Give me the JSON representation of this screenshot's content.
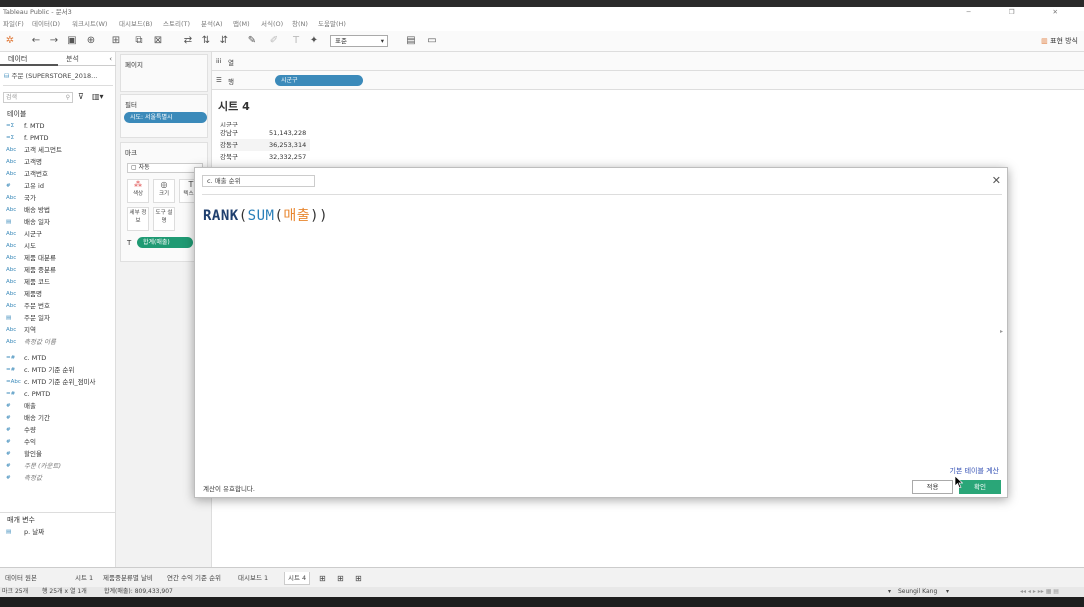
{
  "window": {
    "title": "Tableau Public - 문서3"
  },
  "menu": [
    "파일(F)",
    "데이터(D)",
    "워크시트(W)",
    "대시보드(B)",
    "스토리(T)",
    "분석(A)",
    "맵(M)",
    "서식(O)",
    "창(N)",
    "도움말(H)"
  ],
  "toolbar": {
    "fit_value": "표준",
    "show_me_label": "표현 방식"
  },
  "data_pane": {
    "tab_data": "데이터",
    "tab_analytics": "분석",
    "datasource": "주문 (SUPERSTORE_2018...",
    "search_placeholder": "검색",
    "tables_header": "테이블",
    "fields": [
      {
        "icon": "=Σ",
        "name": "f. MTD"
      },
      {
        "icon": "=Σ",
        "name": "f. PMTD"
      },
      {
        "icon": "Abc",
        "name": "고객 세그먼트"
      },
      {
        "icon": "Abc",
        "name": "고객명"
      },
      {
        "icon": "Abc",
        "name": "고객번호"
      },
      {
        "icon": "#",
        "name": "고유 id"
      },
      {
        "icon": "Abc",
        "name": "국가"
      },
      {
        "icon": "Abc",
        "name": "배송 방법"
      },
      {
        "icon": "▤",
        "name": "배송 일자"
      },
      {
        "icon": "Abc",
        "name": "시군구"
      },
      {
        "icon": "Abc",
        "name": "시도"
      },
      {
        "icon": "Abc",
        "name": "제품 대분류"
      },
      {
        "icon": "Abc",
        "name": "제품 중분류"
      },
      {
        "icon": "Abc",
        "name": "제품 코드"
      },
      {
        "icon": "Abc",
        "name": "제품명"
      },
      {
        "icon": "Abc",
        "name": "주문 번호"
      },
      {
        "icon": "▤",
        "name": "주문 일자"
      },
      {
        "icon": "Abc",
        "name": "지역"
      },
      {
        "icon": "Abc",
        "name": "측정값 이름",
        "italic": true
      },
      {
        "icon": "=#",
        "name": "c. MTD"
      },
      {
        "icon": "=#",
        "name": "c. MTD 기준 순위"
      },
      {
        "icon": "=Abc",
        "name": "c. MTD 기준 순위_점미사"
      },
      {
        "icon": "=#",
        "name": "c. PMTD"
      },
      {
        "icon": "#",
        "name": "매출"
      },
      {
        "icon": "#",
        "name": "배송 기간"
      },
      {
        "icon": "#",
        "name": "수량"
      },
      {
        "icon": "#",
        "name": "수익"
      },
      {
        "icon": "#",
        "name": "할인율"
      },
      {
        "icon": "#",
        "name": "주문 (카운트)",
        "italic": true
      },
      {
        "icon": "#",
        "name": "측정값",
        "italic": true
      }
    ],
    "params_header": "매개 변수",
    "params": [
      {
        "icon": "▤",
        "name": "p. 날짜"
      }
    ]
  },
  "shelves": {
    "pages_label": "페이지",
    "filters_label": "필터",
    "filter_pill": "시도: 서울특별시",
    "marks_label": "마크",
    "mark_type": "자동",
    "mark_buttons": [
      "색상",
      "크기",
      "텍스트",
      "세부 정보",
      "도구 설명"
    ],
    "mark_pill": "합계(매출)",
    "columns_label": "열",
    "rows_label": "행",
    "rows_pill": "시군구"
  },
  "view": {
    "sheet_title": "시트 4",
    "column_header": "시군구",
    "rows": [
      {
        "name": "강남구",
        "value": "51,143,228"
      },
      {
        "name": "강동구",
        "value": "36,253,314"
      },
      {
        "name": "강북구",
        "value": "32,332,257"
      }
    ]
  },
  "dialog": {
    "calc_name": "c. 매출 순위",
    "formula": {
      "func1": "RANK",
      "func2": "SUM",
      "field": "매출"
    },
    "validity": "계산이 유효합니다.",
    "dependencies_link": "기본 테이블 계산",
    "apply_label": "적용",
    "ok_label": "확인"
  },
  "sheet_tabs": [
    "데이터 원본",
    "시트 1",
    "제품중분류별 날비",
    "연간 수익 기준 순위",
    "대시보드 1",
    "시트 4"
  ],
  "status": {
    "marks": "마크 25개",
    "rows_cols": "행 25개 x 열 1개",
    "sum": "합계(매출): 809,433,907",
    "user": "Seungil Kang"
  }
}
